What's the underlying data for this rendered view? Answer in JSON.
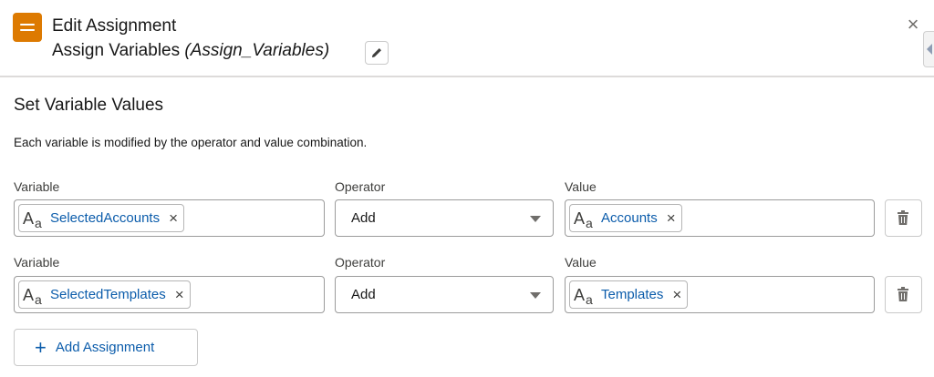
{
  "header": {
    "title": "Edit Assignment",
    "subtitle_label": "Assign Variables",
    "subtitle_api_name": "(Assign_Variables)",
    "icon": "assignment-icon",
    "edit_icon": "pencil-icon",
    "close_icon": "close-icon",
    "close_glyph": "×",
    "accent_color": "#dd7a01"
  },
  "section": {
    "title": "Set Variable Values",
    "description": "Each variable is modified by the operator and value combination."
  },
  "rows": [
    {
      "variable_label": "Variable",
      "variable_value": "SelectedAccounts",
      "operator_label": "Operator",
      "operator_value": "Add",
      "value_label": "Value",
      "value_value": "Accounts"
    },
    {
      "variable_label": "Variable",
      "variable_value": "SelectedTemplates",
      "operator_label": "Operator",
      "operator_value": "Add",
      "value_label": "Value",
      "value_value": "Templates"
    }
  ],
  "pill": {
    "type_icon": "text-type-icon",
    "remove_glyph": "×"
  },
  "add_button": {
    "label": "Add Assignment",
    "glyph": "+",
    "icon": "add-icon"
  },
  "delete_icon": "trash-icon",
  "link_color": "#0b5cab"
}
